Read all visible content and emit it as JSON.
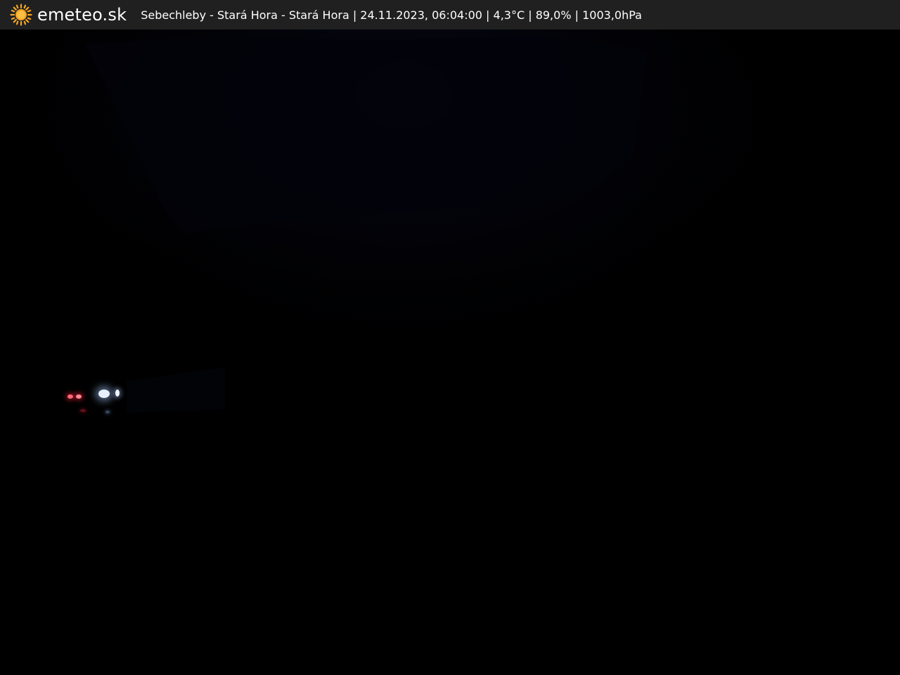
{
  "overlay": {
    "brand": "emeteo.sk",
    "caption": "Sebechleby - Stará Hora - Stará Hora | 24.11.2023, 06:04:00 | 4,3°C | 89,0% | 1003,0hPa",
    "icon": "sun-icon",
    "icon_color": "#f6a623",
    "bar_color": "#202020",
    "text_color": "#ffffff"
  },
  "scene": {
    "background_color": "#000000",
    "vehicle_light_colors": [
      "#ff6a7a",
      "#e6f0ff"
    ]
  }
}
